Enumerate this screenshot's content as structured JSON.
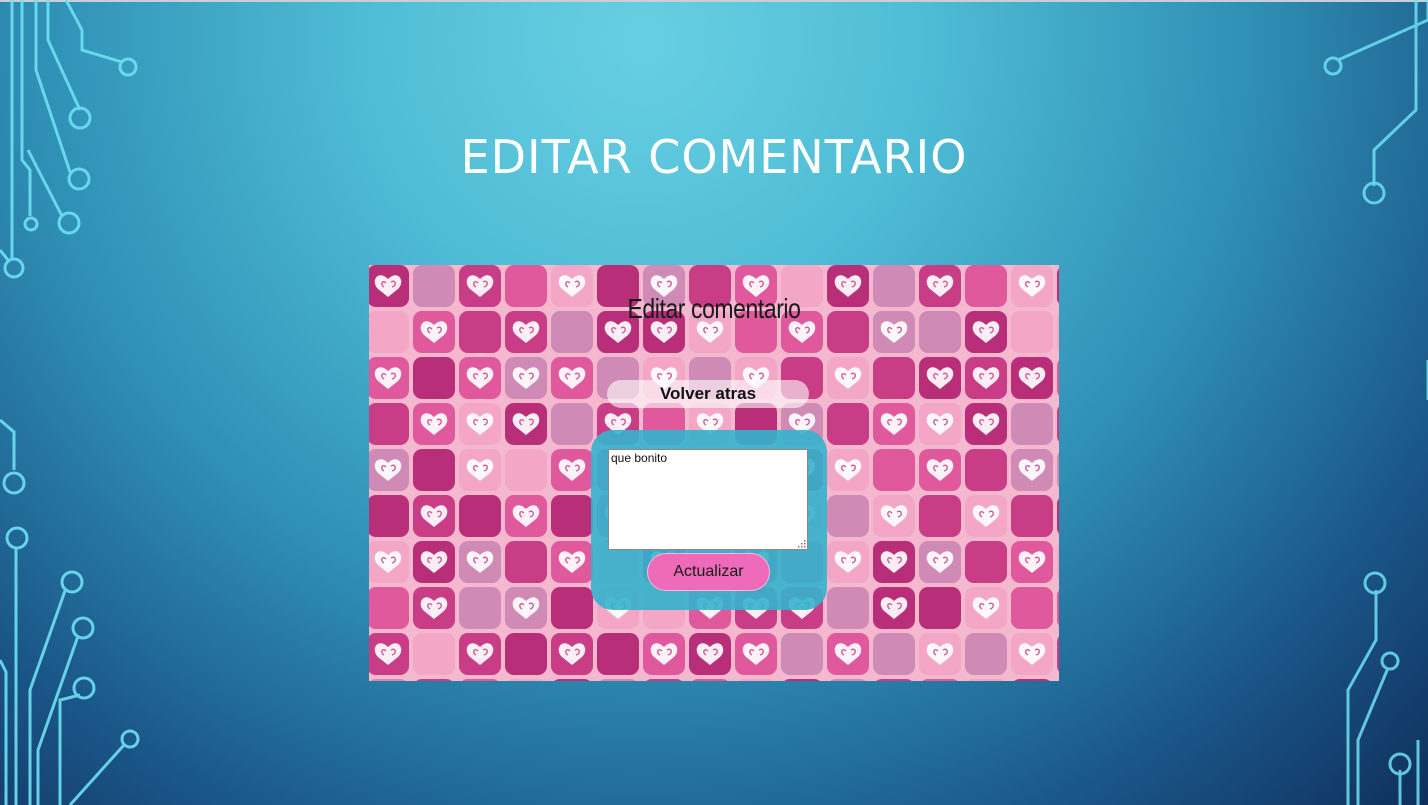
{
  "slide": {
    "title": "EDITAR COMENTARIO"
  },
  "screenshot": {
    "heading": "Editar comentario",
    "back_button_label": "Volver atras",
    "comment_value": "que bonito",
    "update_button_label": "Actualizar"
  },
  "colors": {
    "tile_palette": [
      "#b92e78",
      "#e0599c",
      "#cf8bb6",
      "#f3a6c5",
      "#c93c86"
    ],
    "panel": "#34b2cc",
    "update_button": "#ef6ab8",
    "circuit_stroke": "#6fe0f2"
  },
  "icons": {
    "tile_pattern": "heart-icon",
    "textarea_grip": "resize-grip-icon"
  }
}
